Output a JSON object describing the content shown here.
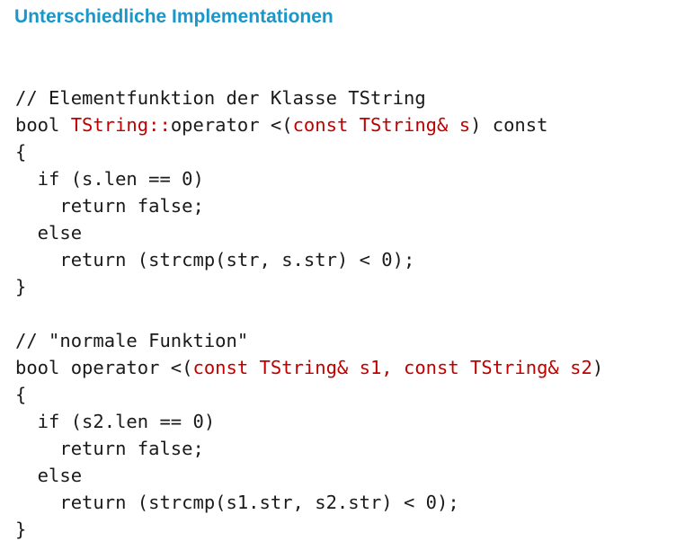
{
  "title": "Unterschiedliche Implementationen",
  "colors": {
    "title": "#1a96c8",
    "code": "#1a1a1a",
    "highlight": "#c00000"
  },
  "code": {
    "lines": [
      [
        {
          "t": "// Elementfunktion der Klasse TString",
          "c": "code"
        }
      ],
      [
        {
          "t": "bool ",
          "c": "code"
        },
        {
          "t": "TString::",
          "c": "highlight"
        },
        {
          "t": "operator <(",
          "c": "code"
        },
        {
          "t": "const TString& s",
          "c": "highlight"
        },
        {
          "t": ") const",
          "c": "code"
        }
      ],
      [
        {
          "t": "{",
          "c": "code"
        }
      ],
      [
        {
          "t": "  if (s.len == 0)",
          "c": "code"
        }
      ],
      [
        {
          "t": "    return false;",
          "c": "code"
        }
      ],
      [
        {
          "t": "  else",
          "c": "code"
        }
      ],
      [
        {
          "t": "    return (strcmp(str, s.str) < 0);",
          "c": "code"
        }
      ],
      [
        {
          "t": "}",
          "c": "code"
        }
      ],
      [],
      [
        {
          "t": "// \"normale Funktion\"",
          "c": "code"
        }
      ],
      [
        {
          "t": "bool operator <(",
          "c": "code"
        },
        {
          "t": "const TString& s1, const TString& s2",
          "c": "highlight"
        },
        {
          "t": ")",
          "c": "code"
        }
      ],
      [
        {
          "t": "{",
          "c": "code"
        }
      ],
      [
        {
          "t": "  if (s2.len == 0)",
          "c": "code"
        }
      ],
      [
        {
          "t": "    return false;",
          "c": "code"
        }
      ],
      [
        {
          "t": "  else",
          "c": "code"
        }
      ],
      [
        {
          "t": "    return (strcmp(s1.str, s2.str) < 0);",
          "c": "code"
        }
      ],
      [
        {
          "t": "}",
          "c": "code"
        }
      ]
    ]
  }
}
